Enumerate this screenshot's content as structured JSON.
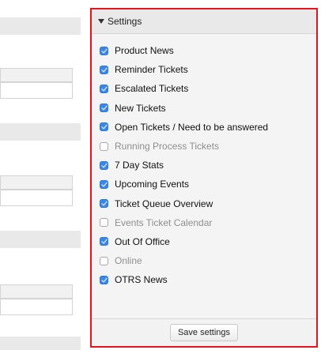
{
  "settings": {
    "title": "Settings",
    "items": [
      {
        "label": "Product News",
        "checked": true
      },
      {
        "label": "Reminder Tickets",
        "checked": true
      },
      {
        "label": "Escalated Tickets",
        "checked": true
      },
      {
        "label": "New Tickets",
        "checked": true
      },
      {
        "label": "Open Tickets / Need to be answered",
        "checked": true
      },
      {
        "label": "Running Process Tickets",
        "checked": false
      },
      {
        "label": "7 Day Stats",
        "checked": true
      },
      {
        "label": "Upcoming Events",
        "checked": true
      },
      {
        "label": "Ticket Queue Overview",
        "checked": true
      },
      {
        "label": "Events Ticket Calendar",
        "checked": false
      },
      {
        "label": "Out Of Office",
        "checked": true
      },
      {
        "label": "Online",
        "checked": false
      },
      {
        "label": "OTRS News",
        "checked": true
      }
    ],
    "save_label": "Save settings"
  },
  "colors": {
    "highlight_border": "#e3141b",
    "checkbox_checked": "#3a87e7",
    "disabled_text": "#8f8f8f"
  }
}
